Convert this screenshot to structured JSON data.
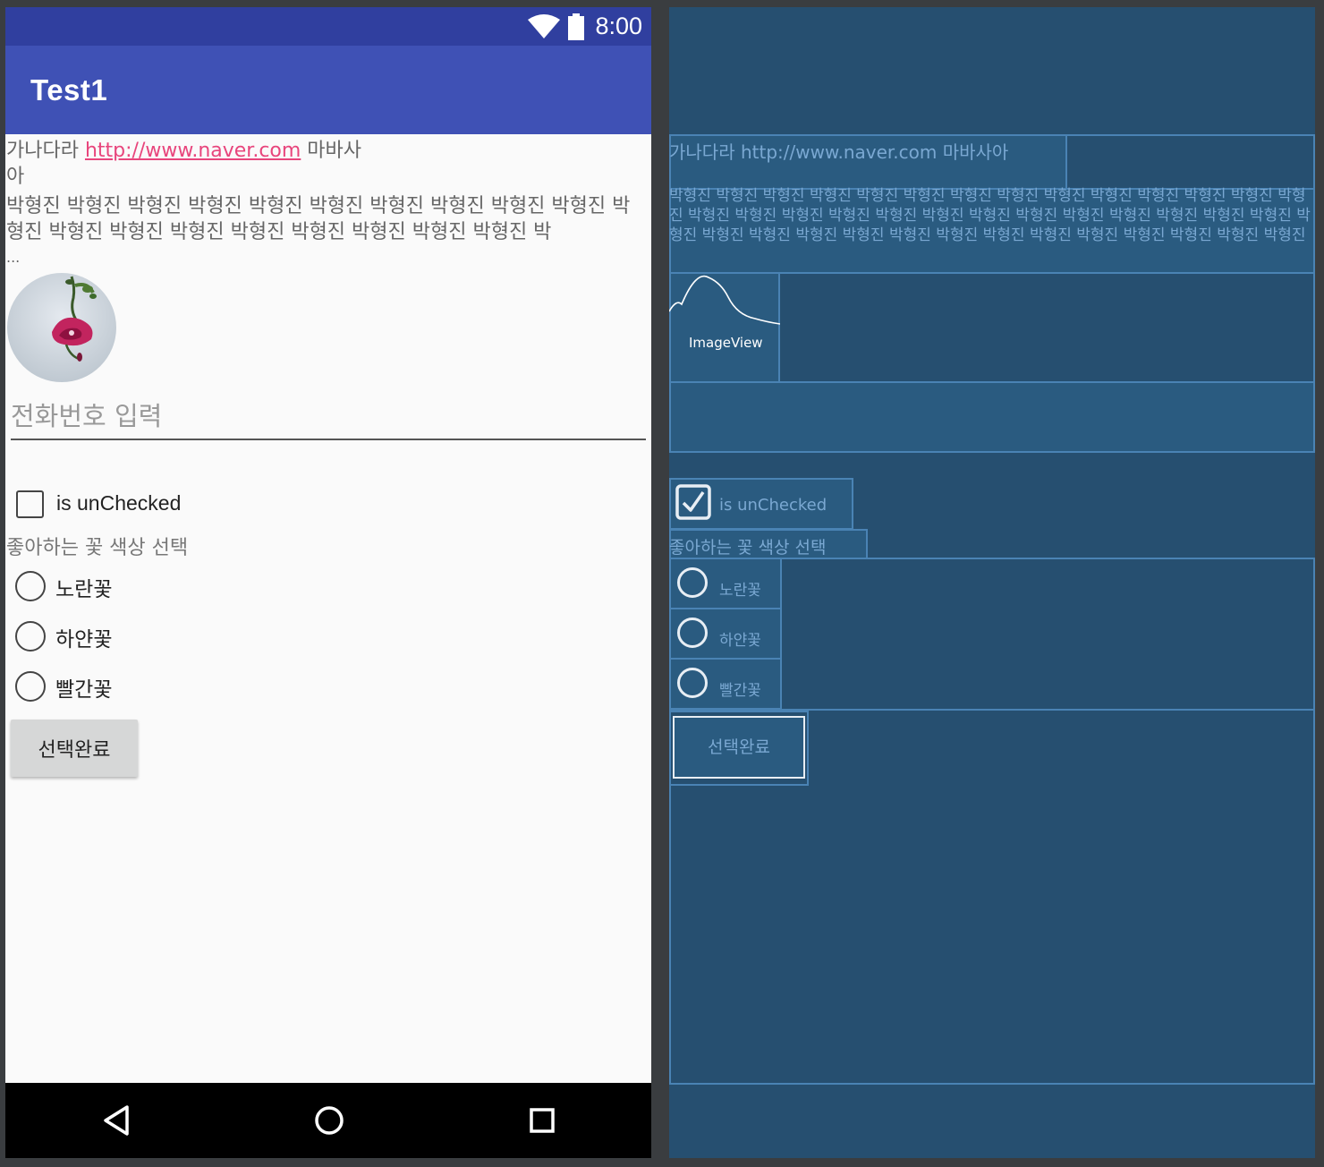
{
  "status_bar": {
    "time": "8:00"
  },
  "app_bar": {
    "title": "Test1"
  },
  "text1": {
    "prefix": "가나다라 ",
    "link": "http://www.naver.com",
    "suffix": " 마바사",
    "wrap": "아"
  },
  "text2": {
    "content": "박형진 박형진 박형진 박형진 박형진 박형진 박형진 박형진 박형진 박형진 박형진 박형진 박형진 박형진 박형진 박형진 박형진 박형진 박형진 박",
    "ellipsis": "..."
  },
  "phone_input": {
    "placeholder": "전화번호 입력",
    "value": ""
  },
  "checkbox": {
    "label": "is unChecked",
    "checked": false
  },
  "radio_group": {
    "title": "좋아하는 꽃 색상 선택",
    "options": [
      "노란꽃",
      "하얀꽃",
      "빨간꽃"
    ]
  },
  "done_button": {
    "label": "선택완료"
  },
  "blueprint": {
    "text1": "가나다라 http://www.naver.com 마바사아",
    "text2": "박형진 박형진 박형진 박형진 박형진 박형진 박형진 박형진 박형진 박형진 박형진 박형진 박형진 박형진 박형진 박형진 박형진 박형진 박형진 박형진 박형진 박형진 박형진 박형진 박형진 박형진 박형진 박형진 박형진 박형진 박형진 박형진 박형진 박형진 박형진 박형진 박형진 박형진 박형진 박형진 박형진",
    "image_label": "ImageView",
    "checkbox_label": "is unChecked",
    "radio_title": "좋아하는 꽃 색상 선택",
    "radio_options": [
      "노란꽃",
      "하얀꽃",
      "빨간꽃"
    ],
    "button_label": "선택완료"
  },
  "colors": {
    "status_bar": "#303f9f",
    "app_bar": "#3f51b5",
    "link": "#e8457c",
    "blueprint_bg": "#264f70"
  }
}
